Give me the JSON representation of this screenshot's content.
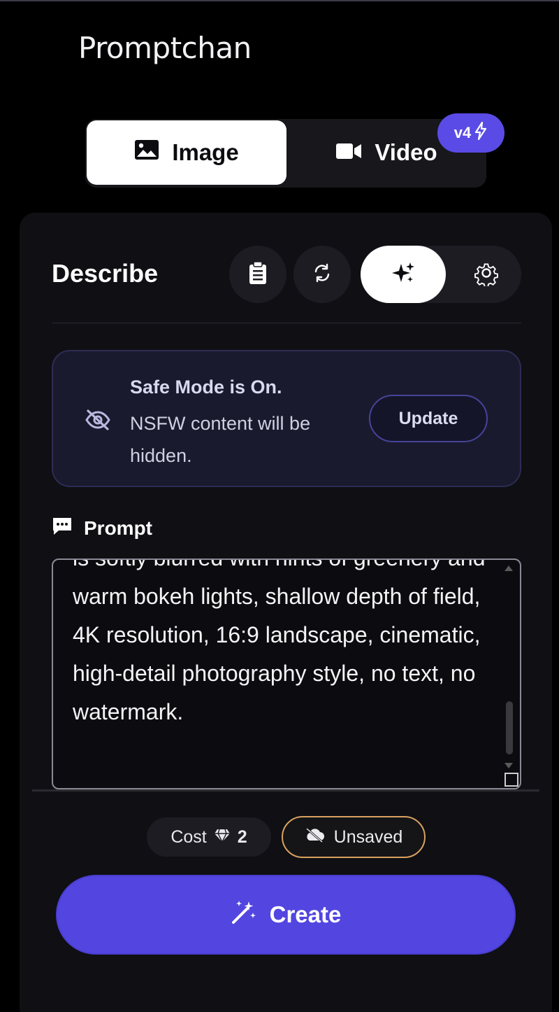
{
  "brand": {
    "name": "Promptchan"
  },
  "mode_switch": {
    "tabs": [
      {
        "label": "Image",
        "icon": "image-icon",
        "selected": true
      },
      {
        "label": "Video",
        "icon": "video-camera-icon",
        "selected": false
      }
    ],
    "video_badge": "v4"
  },
  "describe": {
    "title": "Describe",
    "tools": [
      {
        "icon": "clipboard-icon"
      },
      {
        "icon": "refresh-icon"
      },
      {
        "icon": "sparkles-icon",
        "active": true
      },
      {
        "icon": "gear-icon"
      }
    ]
  },
  "safe_mode": {
    "title": "Safe Mode is On.",
    "description": "NSFW content will be hidden.",
    "button": "Update",
    "icon": "eye-slash-icon"
  },
  "prompt": {
    "label": "Prompt",
    "icon": "chat-bubble-icon",
    "text": "is softly blurred with hints of greenery and warm bokeh lights, shallow depth of field, 4K resolution, 16:9 landscape, cinematic, high-detail photography style, no text, no watermark."
  },
  "footer": {
    "cost_label": "Cost",
    "cost_value": "2",
    "cost_icon": "gem-icon",
    "unsaved_label": "Unsaved",
    "unsaved_icon": "cloud-slash-icon",
    "create_label": "Create",
    "create_icon": "magic-wand-icon"
  },
  "colors": {
    "accent": "#5245e0",
    "badge": "#5a4be6",
    "unsaved_border": "#d9a15e",
    "panel": "#0f0f14"
  }
}
